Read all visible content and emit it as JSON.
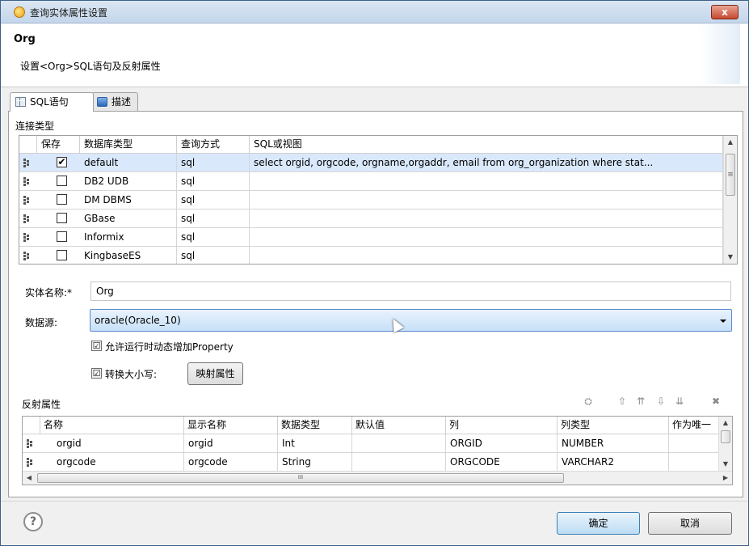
{
  "window": {
    "title": "查询实体属性设置",
    "close_label": "x"
  },
  "header": {
    "title": "Org",
    "description": "设置<Org>SQL语句及反射属性"
  },
  "tabs": [
    {
      "label": "SQL语句",
      "icon": "table-grid-icon",
      "active": true
    },
    {
      "label": "描述",
      "icon": "description-icon",
      "active": false
    }
  ],
  "connection": {
    "section_label": "连接类型",
    "columns": [
      "保存",
      "数据库类型",
      "查询方式",
      "SQL或视图"
    ],
    "rows": [
      {
        "checked": "✔",
        "db_type": "default",
        "query_mode": "sql",
        "sql": "select orgid, orgcode, orgname,orgaddr, email from org_organization where stat..."
      },
      {
        "checked": "",
        "db_type": "DB2 UDB",
        "query_mode": "sql",
        "sql": ""
      },
      {
        "checked": "",
        "db_type": "DM DBMS",
        "query_mode": "sql",
        "sql": ""
      },
      {
        "checked": "",
        "db_type": "GBase",
        "query_mode": "sql",
        "sql": ""
      },
      {
        "checked": "",
        "db_type": "Informix",
        "query_mode": "sql",
        "sql": ""
      },
      {
        "checked": "",
        "db_type": "KingbaseES",
        "query_mode": "sql",
        "sql": ""
      }
    ],
    "scroll_glyphs": {
      "up": "▲",
      "down": "▼",
      "grip": "≡"
    }
  },
  "entity": {
    "label": "实体名称:*",
    "value": "Org"
  },
  "datasource": {
    "label": "数据源:",
    "value": "oracle(Oracle_10)"
  },
  "options": {
    "allow_dynamic_property": {
      "label": "允许运行时动态增加Property",
      "checked": "☑"
    },
    "convert_case": {
      "label": "转换大小写:",
      "checked": "☑"
    },
    "map_button": "映射属性"
  },
  "reflection": {
    "section_label": "反射属性",
    "toolbar": {
      "add": "⛭",
      "up": "⇧",
      "top": "⇈",
      "down": "⇩",
      "bottom": "⇊",
      "remove": "✖"
    },
    "columns": [
      "名称",
      "显示名称",
      "数据类型",
      "默认值",
      "列",
      "列类型",
      "作为唯一"
    ],
    "rows": [
      {
        "name": "orgid",
        "display": "orgid",
        "type": "Int",
        "default": "",
        "column": "ORGID",
        "column_type": "NUMBER",
        "unique": ""
      },
      {
        "name": "orgcode",
        "display": "orgcode",
        "type": "String",
        "default": "",
        "column": "ORGCODE",
        "column_type": "VARCHAR2",
        "unique": ""
      }
    ],
    "scroll_glyphs": {
      "up": "▲",
      "down": "▼",
      "left": "◀",
      "right": "▶",
      "grip": "III"
    }
  },
  "buttons": {
    "ok": "确定",
    "cancel": "取消",
    "help": "?"
  }
}
